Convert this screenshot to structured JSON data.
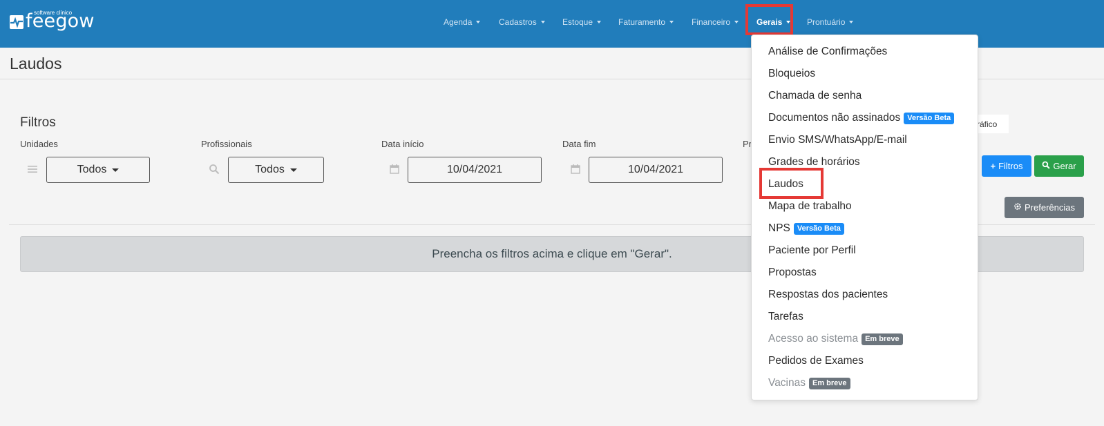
{
  "brand": {
    "small": "software clínico",
    "name": "feegow"
  },
  "nav": [
    {
      "label": "Agenda",
      "active": false
    },
    {
      "label": "Cadastros",
      "active": false
    },
    {
      "label": "Estoque",
      "active": false
    },
    {
      "label": "Faturamento",
      "active": false
    },
    {
      "label": "Financeiro",
      "active": false
    },
    {
      "label": "Gerais",
      "active": true
    },
    {
      "label": "Prontuário",
      "active": false
    }
  ],
  "page": {
    "title": "Laudos"
  },
  "filters": {
    "heading": "Filtros",
    "unidades": {
      "label": "Unidades",
      "value": "Todos",
      "icon": "list-icon"
    },
    "profissionais": {
      "label": "Profissionais",
      "value": "Todos",
      "icon": "search-icon"
    },
    "data_inicio": {
      "label": "Data início",
      "value": "10/04/2021",
      "icon": "calendar-icon"
    },
    "data_fim": {
      "label": "Data fim",
      "value": "10/04/2021",
      "icon": "calendar-icon"
    },
    "partial_label": "Pr",
    "grafico_tab": "ráfico"
  },
  "buttons": {
    "filtros": "Filtros",
    "gerar": "Gerar",
    "preferencias": "Preferências"
  },
  "info_message": "Preencha os filtros acima e clique em \"Gerar\".",
  "dropdown": {
    "items": [
      {
        "label": "Análise de Confirmações"
      },
      {
        "label": "Bloqueios"
      },
      {
        "label": "Chamada de senha"
      },
      {
        "label": "Documentos não assinados",
        "badge": "Versão Beta"
      },
      {
        "label": "Envio SMS/WhatsApp/E-mail"
      },
      {
        "label": "Grades de horários"
      },
      {
        "label": "Laudos"
      },
      {
        "label": "Mapa de trabalho"
      },
      {
        "label": "NPS",
        "badge": "Versão Beta"
      },
      {
        "label": "Paciente por Perfil"
      },
      {
        "label": "Propostas"
      },
      {
        "label": "Respostas dos pacientes"
      },
      {
        "label": "Tarefas"
      },
      {
        "label": "Acesso ao sistema",
        "badge": "Em breve",
        "disabled": true
      },
      {
        "label": "Pedidos de Exames"
      },
      {
        "label": "Vacinas",
        "badge": "Em breve",
        "disabled": true
      }
    ]
  },
  "colors": {
    "topbar": "#217dbb",
    "highlight": "#e53935",
    "beta_badge": "#1a8cf7",
    "soon_badge": "#6c757d",
    "gerar": "#2aa04a",
    "filtros": "#1a8cf7"
  }
}
